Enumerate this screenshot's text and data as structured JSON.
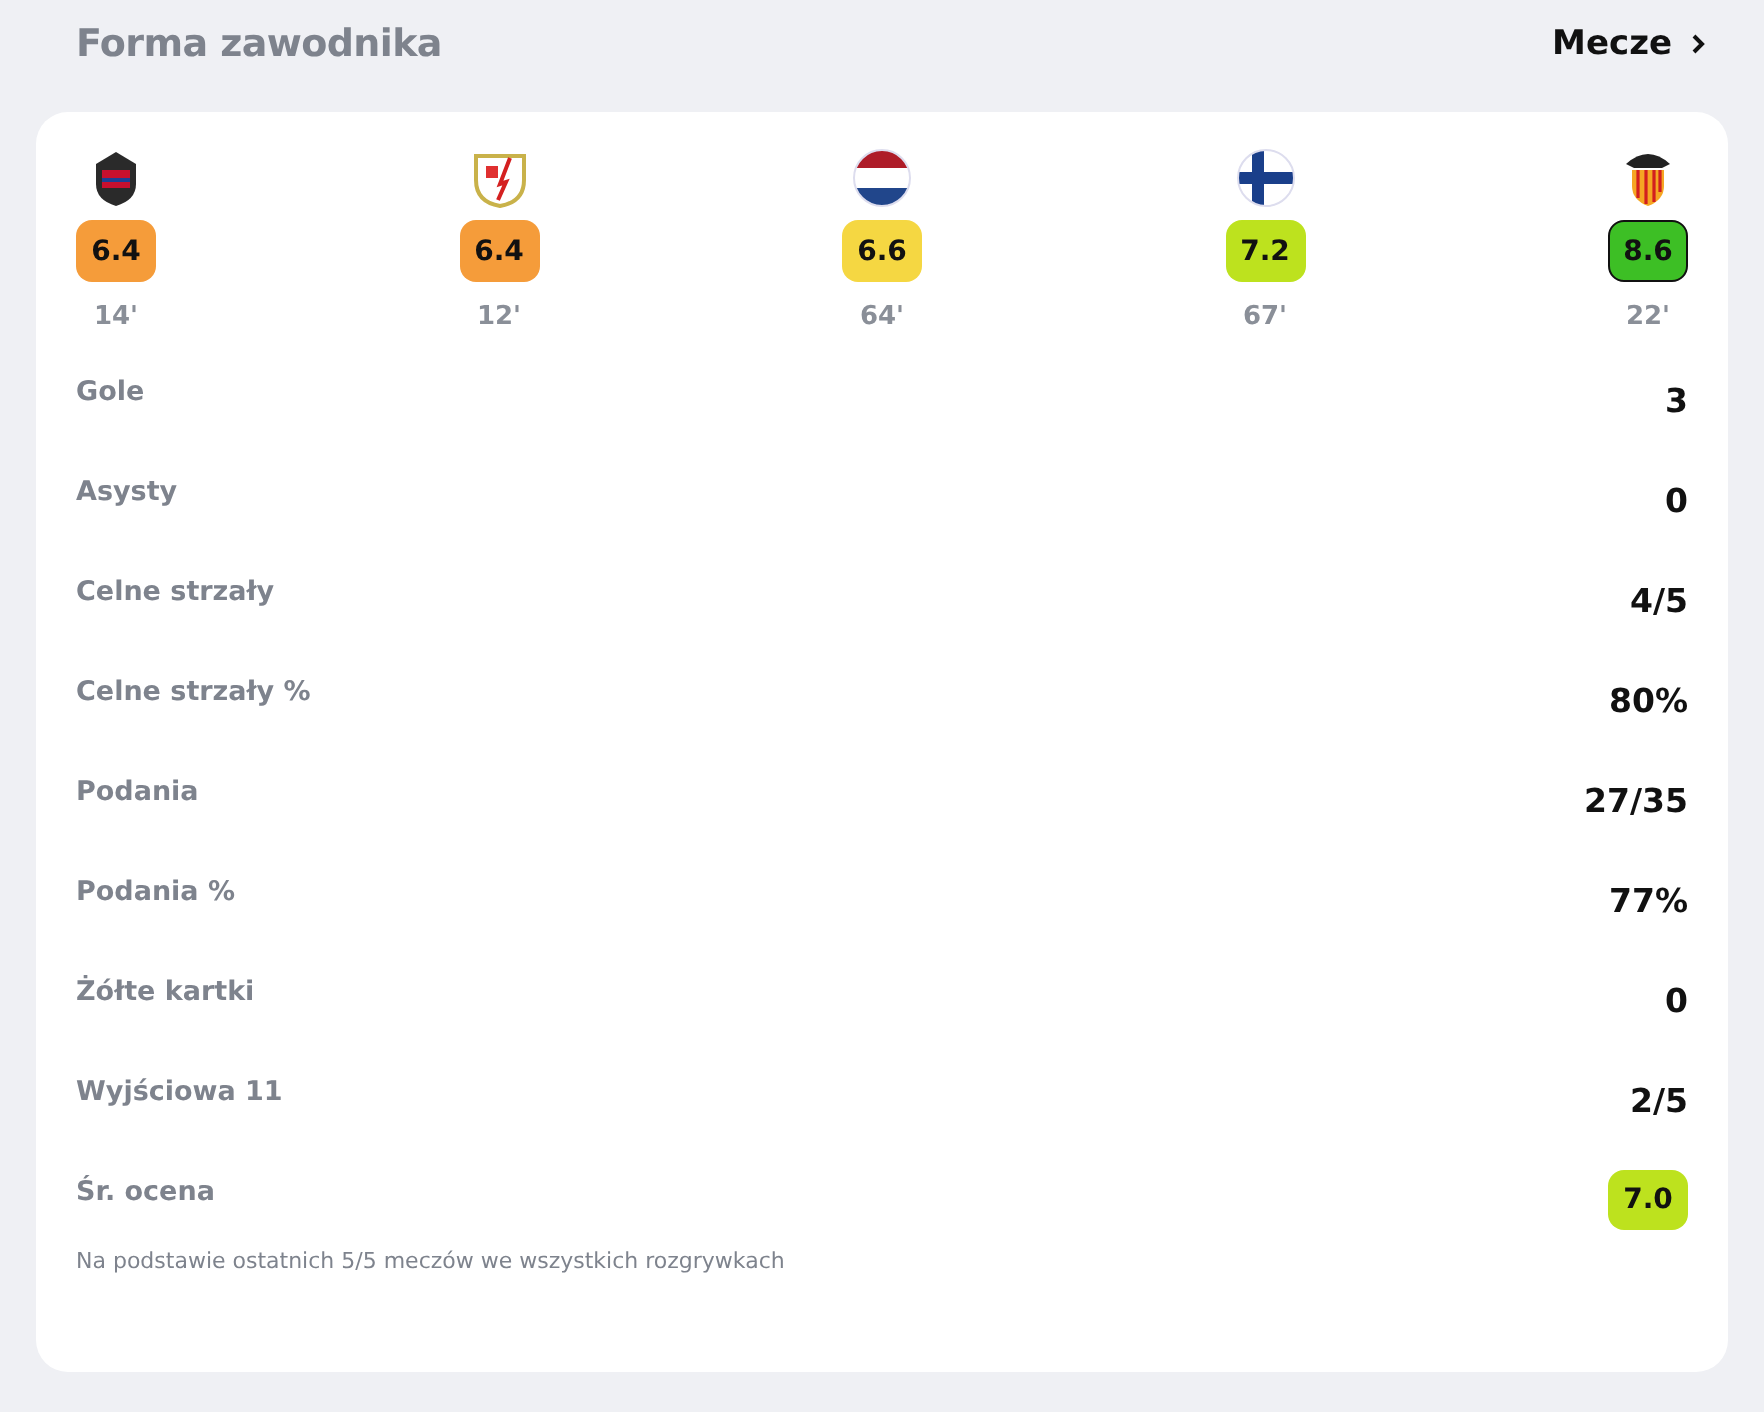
{
  "header": {
    "title": "Forma zawodnika",
    "link": "Mecze"
  },
  "matches": [
    {
      "kind": "shield",
      "rating": "6.4",
      "color": "#f59c3a",
      "minutes": "14'",
      "selected": false
    },
    {
      "kind": "badge",
      "rating": "6.4",
      "color": "#f59c3a",
      "minutes": "12'",
      "selected": false
    },
    {
      "kind": "netherlands",
      "rating": "6.6",
      "color": "#f5d742",
      "minutes": "64'",
      "selected": false
    },
    {
      "kind": "finland",
      "rating": "7.2",
      "color": "#bde21e",
      "minutes": "67'",
      "selected": false
    },
    {
      "kind": "bat",
      "rating": "8.6",
      "color": "#3dbf25",
      "minutes": "22'",
      "selected": true
    }
  ],
  "stats": [
    {
      "label": "Gole",
      "value": "3"
    },
    {
      "label": "Asysty",
      "value": "0"
    },
    {
      "label": "Celne strzały",
      "value": "4/5"
    },
    {
      "label": "Celne strzały %",
      "value": "80%"
    },
    {
      "label": "Podania",
      "value": "27/35"
    },
    {
      "label": "Podania %",
      "value": "77%"
    },
    {
      "label": "Żółte kartki",
      "value": "0"
    },
    {
      "label": "Wyjściowa 11",
      "value": "2/5"
    },
    {
      "label": "Śr. ocena",
      "value": "7.0",
      "kind": "rating",
      "color": "#bde21e"
    }
  ],
  "footnote": "Na podstawie ostatnich 5/5 meczów we wszystkich rozgrywkach"
}
